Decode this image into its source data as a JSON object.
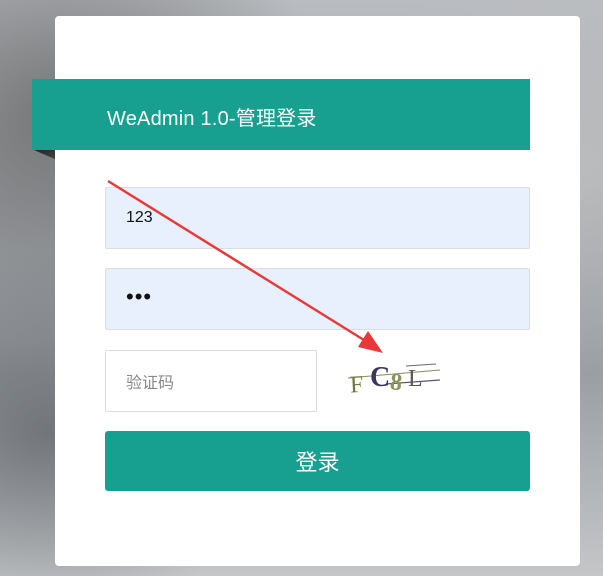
{
  "header": {
    "title": "WeAdmin 1.0-管理登录"
  },
  "form": {
    "username_value": "123",
    "password_masked": "•••",
    "captcha_placeholder": "验证码",
    "captcha_text": "FC8L",
    "login_label": "登录"
  },
  "colors": {
    "accent": "#17a08f",
    "autofill_bg": "#e8f0fe",
    "annotation_arrow": "#e8393a"
  }
}
